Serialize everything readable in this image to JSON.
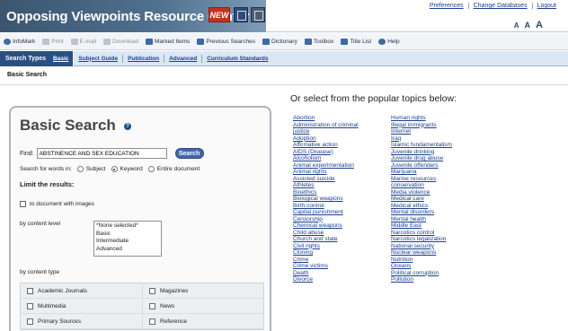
{
  "header": {
    "title": "Opposing Viewpoints Resource Center",
    "new_badge": "NEW",
    "links": [
      "Preferences",
      "Change Databases",
      "Logout"
    ],
    "text_sizes": [
      "A",
      "A",
      "A"
    ]
  },
  "toolbar": {
    "items": [
      {
        "label": "InfoMark",
        "icon": "infomark-icon",
        "enabled": true
      },
      {
        "label": "Print",
        "icon": "print-icon",
        "enabled": false
      },
      {
        "label": "E-mail",
        "icon": "email-icon",
        "enabled": false
      },
      {
        "label": "Download",
        "icon": "download-icon",
        "enabled": false
      },
      {
        "label": "Marked Items",
        "icon": "marked-items-icon",
        "enabled": true
      },
      {
        "label": "Previous Searches",
        "icon": "previous-searches-icon",
        "enabled": true
      },
      {
        "label": "Dictionary",
        "icon": "dictionary-icon",
        "enabled": true
      },
      {
        "label": "Toolbox",
        "icon": "toolbox-icon",
        "enabled": true
      },
      {
        "label": "Title List",
        "icon": "title-list-icon",
        "enabled": true
      },
      {
        "label": "Help",
        "icon": "help-icon",
        "enabled": true
      }
    ]
  },
  "nav": {
    "label": "Search Types",
    "tabs": [
      "Basic",
      "Subject Guide",
      "Publication",
      "Advanced",
      "Curriculum Standards"
    ]
  },
  "breadcrumb": "Basic Search",
  "basic_search": {
    "title": "Basic Search",
    "help": "?",
    "find_label": "Find:",
    "find_value": "ABSTINENCE AND SEX EDUCATION",
    "search_button": "Search",
    "search_for_label": "Search for words in:",
    "scopes": [
      {
        "label": "Subject",
        "selected": false
      },
      {
        "label": "Keyword",
        "selected": true
      },
      {
        "label": "Entire document",
        "selected": false
      }
    ],
    "limit_heading": "Limit the results:",
    "images_label": "to document with images",
    "content_level_label": "by content level",
    "content_levels": [
      "*None selected*",
      "Basic",
      "Intermediate",
      "Advanced"
    ],
    "content_type_label": "by content type",
    "content_types": [
      "Academic Journals",
      "Magazines",
      "Multimedia",
      "News",
      "Primary Sources",
      "Reference"
    ]
  },
  "popular": {
    "title": "Or select from the popular topics below:",
    "col1": [
      "Abortion",
      "Administration of criminal",
      "justice",
      "Adoption",
      "Affirmative action",
      "AIDS (Disease)",
      "Alcoholism",
      "Animal experimentation",
      "Animal rights",
      "Assisted suicide",
      "Athletes",
      "Bioethics",
      "Biological weapons",
      "Birth control",
      "Capital punishment",
      "Censorship",
      "Chemical weapons",
      "Child abuse",
      "Church and state",
      "Civil rights",
      "Cloning",
      "Crime",
      "Crime victims",
      "Death",
      "Divorce"
    ],
    "col2": [
      "Human rights",
      "Illegal immigrants",
      "Internet",
      "Iraq",
      "Islamic fundamentalism",
      "Juvenile drinking",
      "Juvenile drug abuse",
      "Juvenile offenders",
      "Marijuana",
      "Marine resources",
      "conservation",
      "Media violence",
      "Medical care",
      "Medical ethics",
      "Mental disorders",
      "Mental health",
      "Middle East",
      "Narcotics control",
      "Narcotics legalization",
      "National security",
      "Nuclear weapons",
      "Nutrition",
      "Oceans",
      "Political corruption",
      "Pollution"
    ]
  },
  "colors": {
    "brand": "#3b556f",
    "nav": "#2a4f83",
    "link": "#1b3f8f",
    "badge": "#c8301b"
  }
}
